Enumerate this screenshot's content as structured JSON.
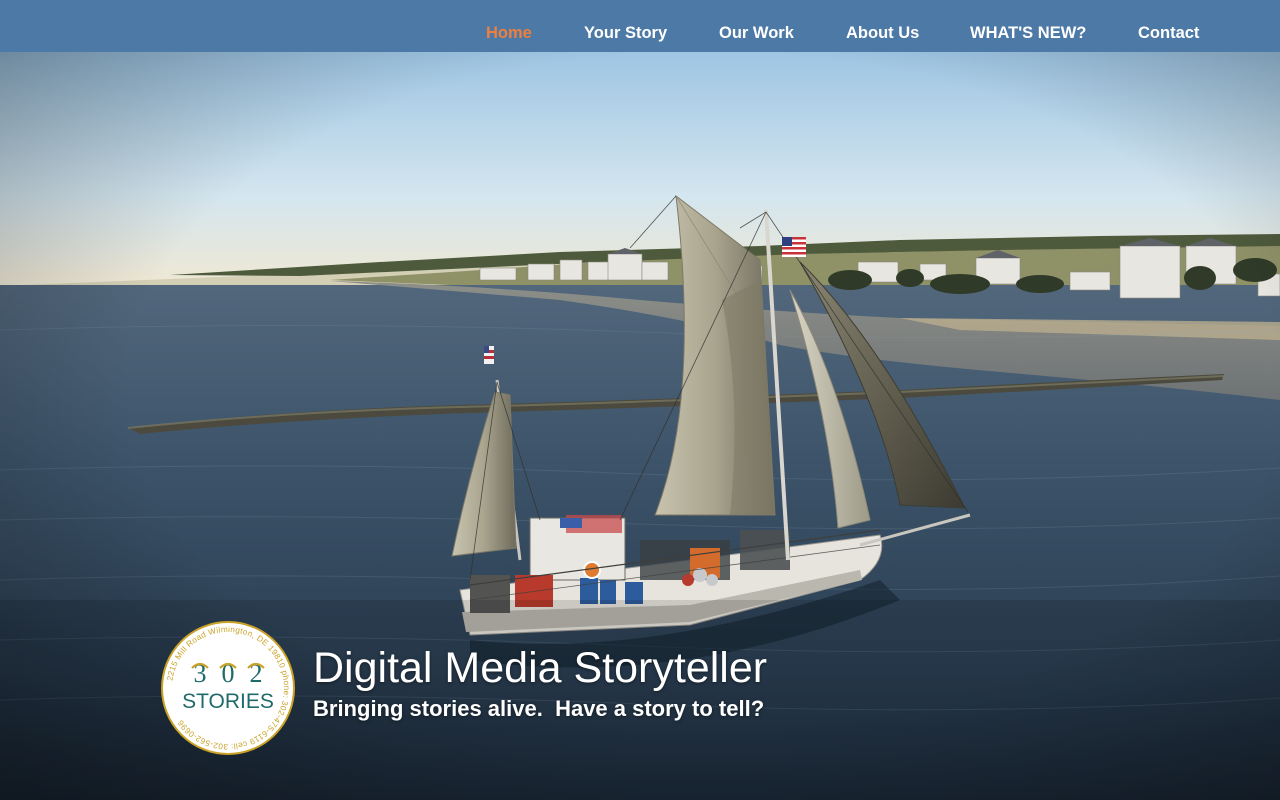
{
  "nav": {
    "items": [
      {
        "label": "Home",
        "active": true
      },
      {
        "label": "Your Story",
        "active": false
      },
      {
        "label": "Our Work",
        "active": false
      },
      {
        "label": "About Us",
        "active": false
      },
      {
        "label": "WHAT'S NEW?",
        "active": false
      },
      {
        "label": "Contact",
        "active": false
      }
    ]
  },
  "hero": {
    "headline": "Digital Media Storyteller",
    "tagline": "Bringing stories alive.  Have a story to tell?"
  },
  "logo": {
    "digits": [
      "3",
      "0",
      "2"
    ],
    "wordmark": "STORIES",
    "ring_text": "2215 Mill Road Wilmington, DE 19810 phone: 302-475-6119 cell: 302-562-0696"
  },
  "colors": {
    "nav_background": "#4d79a6",
    "nav_active": "#ef7f3e",
    "nav_text": "#ffffff",
    "logo_teal": "#1f6b6a",
    "logo_gold": "#c9a227"
  }
}
